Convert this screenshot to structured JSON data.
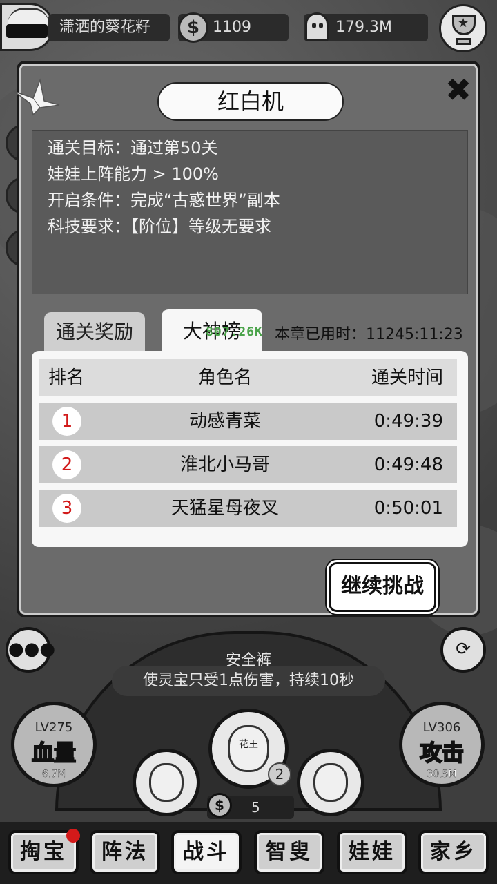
{
  "topbar": {
    "player_name": "潇洒的葵花籽",
    "coins": "1109",
    "souls": "179.3M"
  },
  "dialog": {
    "title": "红白机",
    "info_lines": [
      "通关目标：通过第50关",
      "娃娃上阵能力 > 100%",
      "开启条件：完成“古惑世界”副本",
      "科技要求：【阶位】等级无要求"
    ],
    "tabs": [
      "通关奖励",
      "大神榜"
    ],
    "active_tab": "大神榜",
    "chapter_time": "本章已用时：11245:11:23",
    "leaderboard": {
      "headers": [
        "排名",
        "角色名",
        "通关时间"
      ],
      "rows": [
        {
          "rank": "1",
          "name": "动感青菜",
          "time": "0:49:39"
        },
        {
          "rank": "2",
          "name": "淮北小马哥",
          "time": "0:49:48"
        },
        {
          "rank": "3",
          "name": "天猛星母夜叉",
          "time": "0:50:01"
        }
      ]
    },
    "floating_number": "807.26K",
    "continue_label": "继续挑战"
  },
  "hud": {
    "skill_name": "安全裤",
    "skill_desc": "使灵宝只受1点伤害，持续10秒",
    "left_stat": {
      "level": "LV275",
      "label": "血量",
      "value": "6.7M"
    },
    "right_stat": {
      "level": "LV306",
      "label": "攻击",
      "value": "30.5M"
    },
    "hero_count": "2",
    "cost": "5",
    "center_hero_text": "花王"
  },
  "nav": {
    "items": [
      "掏宝",
      "阵法",
      "战斗",
      "智叟",
      "娃娃",
      "家乡"
    ],
    "active": "战斗"
  },
  "colors": {
    "rank_red": "#d21a1a",
    "floating_number_green": "#4aa34a",
    "notification_red": "#d41a1a"
  }
}
